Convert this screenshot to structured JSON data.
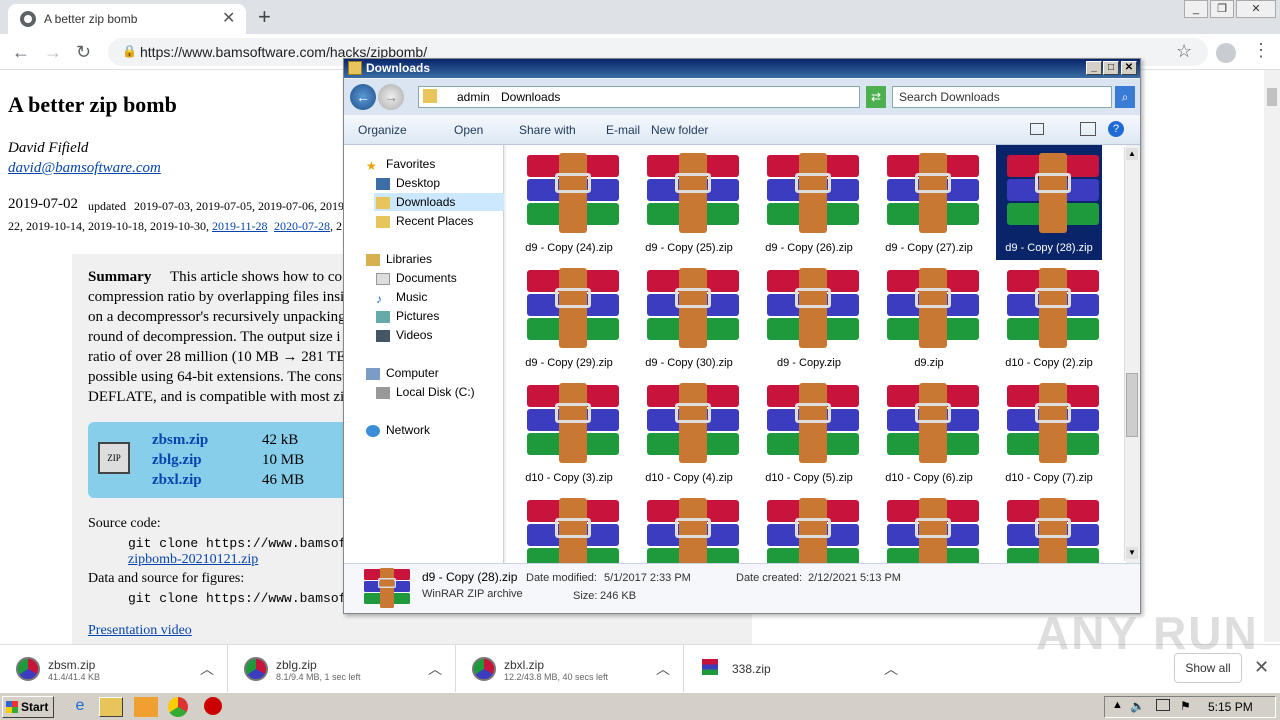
{
  "browser": {
    "tab_title": "A better zip bomb",
    "tab_close": "✕",
    "new_tab": "+",
    "url": "https://www.bamsoftware.com/hacks/zipbomb/",
    "back": "←",
    "forward": "→",
    "reload": "↻",
    "star": "☆",
    "menu": "⋮",
    "window_min": "_",
    "window_max": "❐",
    "window_close": "✕"
  },
  "page": {
    "title": "A better zip bomb",
    "author": "David Fifield",
    "email": "david@bamsoftware.com",
    "date_main": "2019-07-02",
    "updated_label": "updated",
    "updated_line1": "2019-07-03, 2019-07-05, 2019-07-06, 2019",
    "updated_line2a": "22, 2019-10-14, 2019-10-18, 2019-10-30,",
    "updated_link1": "2019-11-28",
    "updated_link2": "2020-07-28",
    "updated_tail": ", 2",
    "summary_label": "Summary",
    "summary_lines": [
      "This article shows how to co",
      "compression ratio by overlapping files insid",
      "on a decompressor's recursively unpacking",
      "round of decompression. The output size i",
      "ratio of over 28 million (10 MB → 281 TE",
      "possible using 64-bit extensions. The const",
      "DEFLATE, and is compatible with most zi"
    ],
    "downloads": [
      {
        "name": "zbsm.zip",
        "size": "42 kB"
      },
      {
        "name": "zblg.zip",
        "size": "10 MB"
      },
      {
        "name": "zbxl.zip",
        "size": "46 MB"
      }
    ],
    "source_label": "Source code:",
    "source_cmd": "git clone https://www.bamsoftwa",
    "source_zip": "zipbomb-20210121.zip",
    "data_label": "Data and source for figures:",
    "data_cmd": "git clone https://www.bamsoftwa",
    "video_link": "Presentation video"
  },
  "explorer": {
    "title": "Downloads",
    "breadcrumb": [
      "admin",
      "Downloads"
    ],
    "search_placeholder": "Search Downloads",
    "commands": [
      "Organize",
      "Open",
      "Share with",
      "E-mail",
      "New folder"
    ],
    "nav": {
      "favorites": "Favorites",
      "desktop": "Desktop",
      "downloads": "Downloads",
      "recent": "Recent Places",
      "libraries": "Libraries",
      "documents": "Documents",
      "music": "Music",
      "pictures": "Pictures",
      "videos": "Videos",
      "computer": "Computer",
      "localdisk": "Local Disk (C:)",
      "network": "Network"
    },
    "files": [
      "d9 - Copy (24).zip",
      "d9 - Copy (25).zip",
      "d9 - Copy (26).zip",
      "d9 - Copy (27).zip",
      "d9 - Copy (28).zip",
      "d9 - Copy (29).zip",
      "d9 - Copy (30).zip",
      "d9 - Copy.zip",
      "d9.zip",
      "d10 - Copy (2).zip",
      "d10 - Copy (3).zip",
      "d10 - Copy (4).zip",
      "d10 - Copy (5).zip",
      "d10 - Copy (6).zip",
      "d10 - Copy (7).zip",
      "",
      "",
      "",
      "",
      ""
    ],
    "selected_index": 4,
    "details": {
      "name": "d9 - Copy (28).zip",
      "type": "WinRAR ZIP archive",
      "modified_label": "Date modified:",
      "modified": "5/1/2017 2:33 PM",
      "created_label": "Date created:",
      "created": "2/12/2021 5:13 PM",
      "size_label": "Size:",
      "size": "246 KB"
    }
  },
  "shelf": {
    "items": [
      {
        "name": "zbsm.zip",
        "status": "41.4/41.4 KB"
      },
      {
        "name": "zblg.zip",
        "status": "8.1/9.4 MB, 1 sec left"
      },
      {
        "name": "zbxl.zip",
        "status": "12.2/43.8 MB, 40 secs left"
      },
      {
        "name": "338.zip",
        "status": ""
      }
    ],
    "show_all": "Show all",
    "close": "✕"
  },
  "taskbar": {
    "start": "Start",
    "clock": "5:15 PM"
  },
  "watermark": "ANY RUN"
}
